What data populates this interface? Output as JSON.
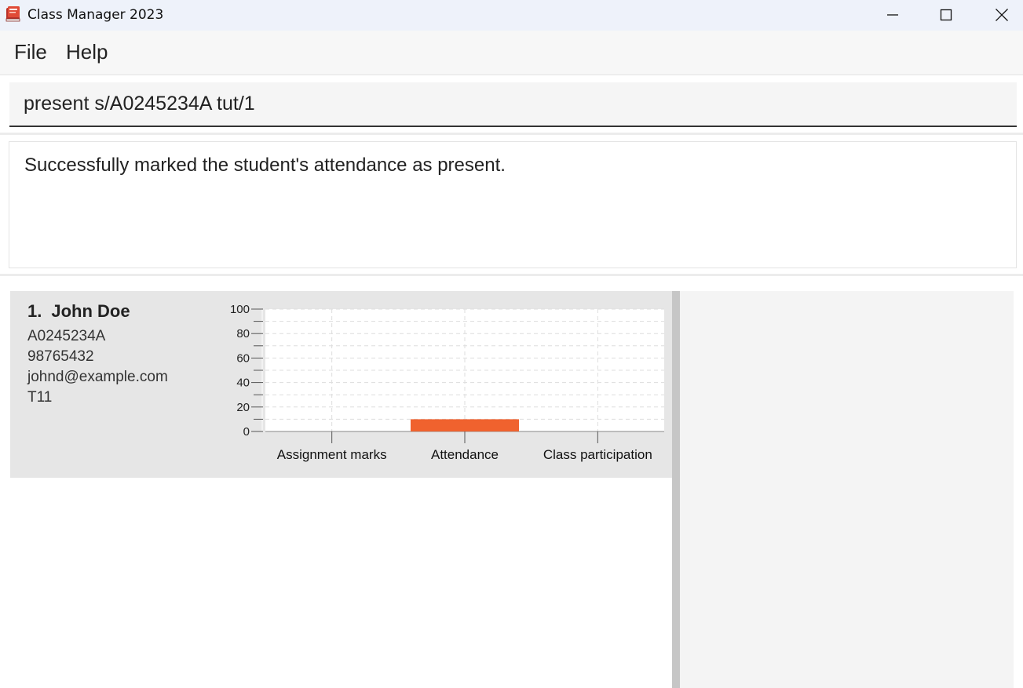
{
  "window": {
    "title": "Class Manager 2023",
    "controls": [
      "minimize",
      "maximize",
      "close"
    ]
  },
  "menu": {
    "items": [
      {
        "label": "File"
      },
      {
        "label": "Help"
      }
    ]
  },
  "command": {
    "value": "present s/A0245234A tut/1"
  },
  "result": {
    "message": "Successfully marked the student's attendance as present."
  },
  "students": [
    {
      "index": "1.",
      "name": "John Doe",
      "student_number": "A0245234A",
      "phone": "98765432",
      "email": "johnd@example.com",
      "class_number": "T11",
      "chart_data": {
        "type": "bar",
        "categories": [
          "Assignment marks",
          "Attendance",
          "Class participation"
        ],
        "values": [
          0,
          10,
          0
        ],
        "ylim": [
          0,
          100
        ],
        "yticks": [
          0,
          20,
          40,
          60,
          80,
          100
        ],
        "grid": true,
        "bar_color": "#f0622e"
      }
    }
  ],
  "colors": {
    "titlebar": "#eef2fa",
    "card_background": "#e6e6e6",
    "bar": "#f0622e"
  }
}
